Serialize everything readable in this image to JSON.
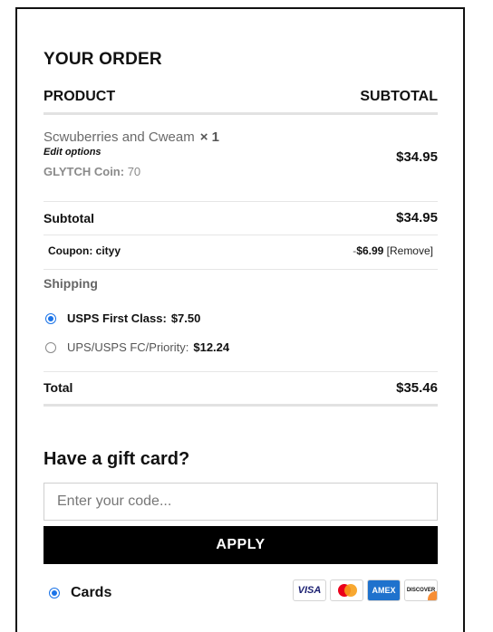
{
  "order": {
    "title": "YOUR ORDER",
    "col_product": "PRODUCT",
    "col_subtotal": "SUBTOTAL",
    "item": {
      "name": "Scwuberries and Cweam",
      "qty": "× 1",
      "edit_options": "Edit options",
      "coin_label": "GLYTCH Coin:",
      "coin_value": "70",
      "price": "$34.95"
    },
    "subtotal_label": "Subtotal",
    "subtotal_value": "$34.95",
    "coupon_label": "Coupon: cityy",
    "coupon_minus": "-",
    "coupon_amount": "$6.99",
    "coupon_remove": "[Remove]",
    "shipping_label": "Shipping",
    "shipping_options": [
      {
        "name": "USPS First Class:",
        "price": "$7.50",
        "selected": true
      },
      {
        "name": "UPS/USPS FC/Priority:",
        "price": "$12.24",
        "selected": false
      }
    ],
    "total_label": "Total",
    "total_value": "$35.46"
  },
  "gift": {
    "title": "Have a gift card?",
    "placeholder": "Enter your code...",
    "apply_label": "APPLY"
  },
  "payment": {
    "method_label": "Cards",
    "cards": [
      "VISA",
      "Mastercard",
      "AMEX",
      "DISCOVER"
    ]
  },
  "colors": {
    "accent": "#1a73e8",
    "button_bg": "#000000"
  }
}
